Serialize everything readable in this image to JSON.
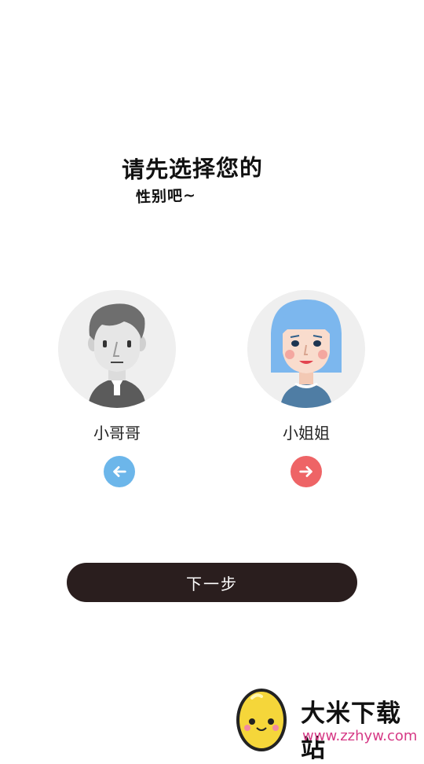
{
  "prompt": {
    "line1": "请先选择您的",
    "line2": "性别吧~"
  },
  "options": {
    "male": {
      "label": "小哥哥",
      "avatar_icon": "boy-avatar-icon",
      "arrow_icon": "arrow-left-icon",
      "color": "#6cb6ea"
    },
    "female": {
      "label": "小姐姐",
      "avatar_icon": "girl-avatar-icon",
      "arrow_icon": "arrow-right-icon",
      "color": "#ee6466"
    }
  },
  "next_button": {
    "label": "下一步",
    "color": "#2a1e1e"
  },
  "watermark": {
    "name": "大米下载站",
    "url": "www.zzhyw.com"
  }
}
